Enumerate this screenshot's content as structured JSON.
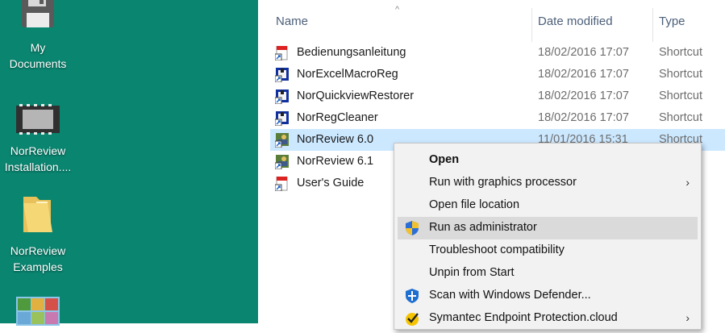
{
  "desktop": {
    "icons": [
      {
        "label": "My\nDocuments",
        "icon": "floppy-disk-icon"
      },
      {
        "label": "NorReview\nInstallation....",
        "icon": "installer-icon"
      },
      {
        "label": "NorReview\nExamples",
        "icon": "folder-icon"
      },
      {
        "label": "",
        "icon": "photo-app-icon"
      }
    ]
  },
  "explorer": {
    "columns": {
      "name": "Name",
      "date": "Date modified",
      "type": "Type"
    },
    "files": [
      {
        "name": "Bedienungsanleitung",
        "date": "18/02/2016 17:07",
        "type": "Shortcut",
        "icon": "pdf-shortcut-icon"
      },
      {
        "name": "NorExcelMacroReg",
        "date": "18/02/2016 17:07",
        "type": "Shortcut",
        "icon": "app-shortcut-icon"
      },
      {
        "name": "NorQuickviewRestorer",
        "date": "18/02/2016 17:07",
        "type": "Shortcut",
        "icon": "app-shortcut-icon"
      },
      {
        "name": "NorRegCleaner",
        "date": "18/02/2016 17:07",
        "type": "Shortcut",
        "icon": "app-shortcut-icon"
      },
      {
        "name": "NorReview 6.0",
        "date": "11/01/2016 15:31",
        "type": "Shortcut",
        "icon": "norreview-shortcut-icon",
        "selected": true
      },
      {
        "name": "NorReview 6.1",
        "date": "",
        "type": "",
        "icon": "norreview-shortcut-icon"
      },
      {
        "name": "User's Guide",
        "date": "",
        "type": "",
        "icon": "pdf-shortcut-icon"
      }
    ]
  },
  "context_menu": {
    "items": [
      {
        "label": "Open",
        "bold": true
      },
      {
        "label": "Run with graphics processor",
        "submenu": true
      },
      {
        "label": "Open file location"
      },
      {
        "label": "Run as administrator",
        "icon": "uac-shield-icon",
        "highlighted": true
      },
      {
        "label": "Troubleshoot compatibility"
      },
      {
        "label": "Unpin from Start"
      },
      {
        "label": "Scan with Windows Defender...",
        "icon": "windows-defender-icon"
      },
      {
        "label": "Symantec Endpoint Protection.cloud",
        "icon": "symantec-icon",
        "submenu": true
      }
    ],
    "submenu_arrow": "›"
  },
  "colors": {
    "desktop": "#0a8570",
    "selection": "#cce8ff",
    "menu_highlight": "#dadada"
  }
}
